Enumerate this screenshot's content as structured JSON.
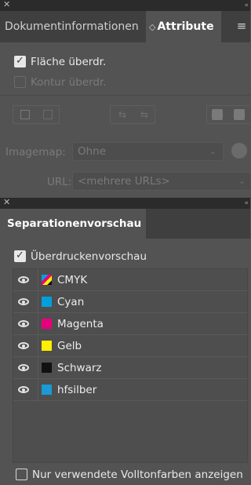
{
  "attributes_panel": {
    "tabs": [
      {
        "label": "Dokumentinformationen"
      },
      {
        "label": "Attribute"
      }
    ],
    "checkboxes": [
      {
        "label": "Fläche überdr.",
        "checked": true,
        "enabled": true
      },
      {
        "label": "Kontur überdr.",
        "checked": false,
        "enabled": false
      }
    ],
    "imagemap": {
      "label": "Imagemap:",
      "value": "Ohne"
    },
    "url": {
      "label": "URL:",
      "value": "<mehrere URLs>"
    }
  },
  "separations_panel": {
    "tab_label": "Separationenvorschau",
    "overprint_preview": {
      "label": "Überdruckenvorschau",
      "checked": true
    },
    "separations": [
      {
        "name": "CMYK",
        "color": "cmyk",
        "visible": true
      },
      {
        "name": "Cyan",
        "color": "#00a0e0",
        "visible": true
      },
      {
        "name": "Magenta",
        "color": "#e6007e",
        "visible": true
      },
      {
        "name": "Gelb",
        "color": "#ffef00",
        "visible": true
      },
      {
        "name": "Schwarz",
        "color": "#111111",
        "visible": true
      },
      {
        "name": "hfsilber",
        "color": "#1a9ad6",
        "visible": true
      }
    ],
    "spot_only": {
      "label": "Nur verwendete Volltonfarben anzeigen",
      "checked": false
    }
  }
}
